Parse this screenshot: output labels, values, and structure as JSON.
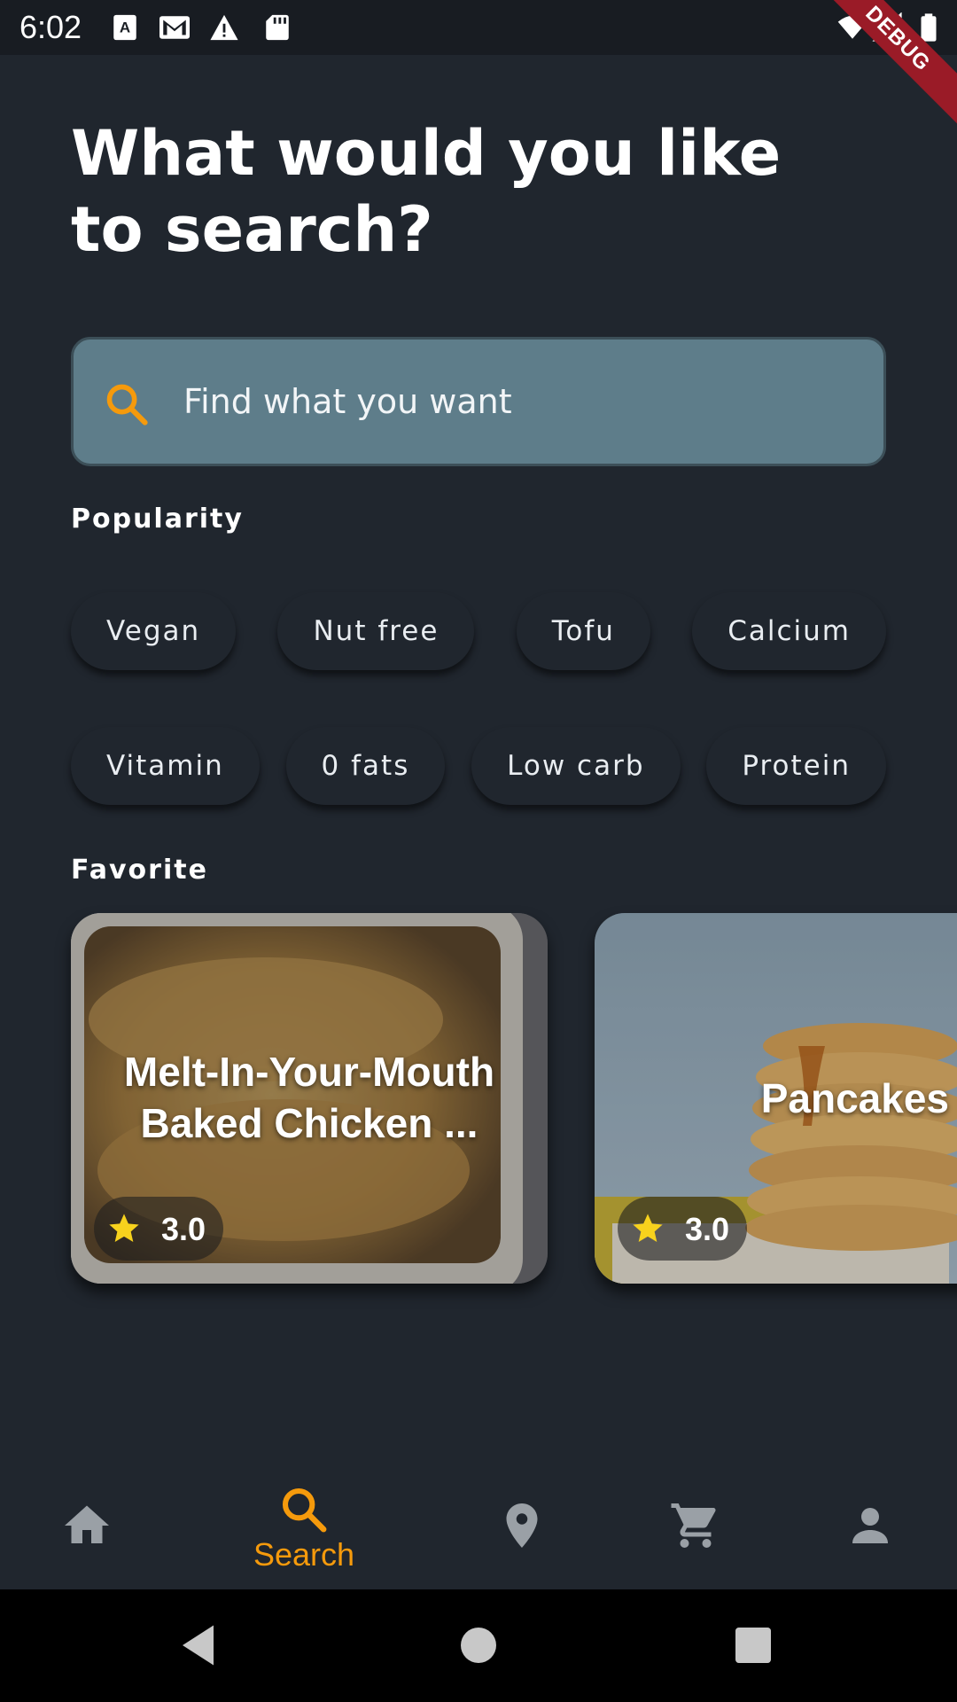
{
  "status_bar": {
    "time": "6:02",
    "icons": [
      "keyboard-a-icon",
      "gmail-icon",
      "warning-icon",
      "sd-card-icon",
      "wifi-icon",
      "signal-icon",
      "battery-icon"
    ],
    "debug_label": "DEBUG"
  },
  "header": {
    "title": "What would you like to search?"
  },
  "search": {
    "placeholder": "Find what you want",
    "value": "",
    "icon": "search-icon"
  },
  "popularity": {
    "label": "Popularity",
    "row1": [
      "Vegan",
      "Nut free",
      "Tofu",
      "Calcium"
    ],
    "row2": [
      "Vitamin",
      "0 fats",
      "Low carb",
      "Protein"
    ]
  },
  "favorite": {
    "label": "Favorite",
    "cards": [
      {
        "title": "Melt-In-Your-Mouth Baked Chicken ...",
        "rating": "3.0"
      },
      {
        "title": "Pancakes",
        "rating": "3.0"
      }
    ]
  },
  "bottom_nav": {
    "items": [
      {
        "icon": "home-icon",
        "label": ""
      },
      {
        "icon": "search-icon",
        "label": "Search",
        "active": true
      },
      {
        "icon": "location-pin-icon",
        "label": ""
      },
      {
        "icon": "cart-icon",
        "label": ""
      },
      {
        "icon": "person-icon",
        "label": ""
      }
    ]
  },
  "colors": {
    "background": "#20262e",
    "accent": "#f59a0c",
    "search_bg": "#5e7d8a",
    "inactive_icon": "#9aa0a6",
    "star": "#f7d21d"
  }
}
